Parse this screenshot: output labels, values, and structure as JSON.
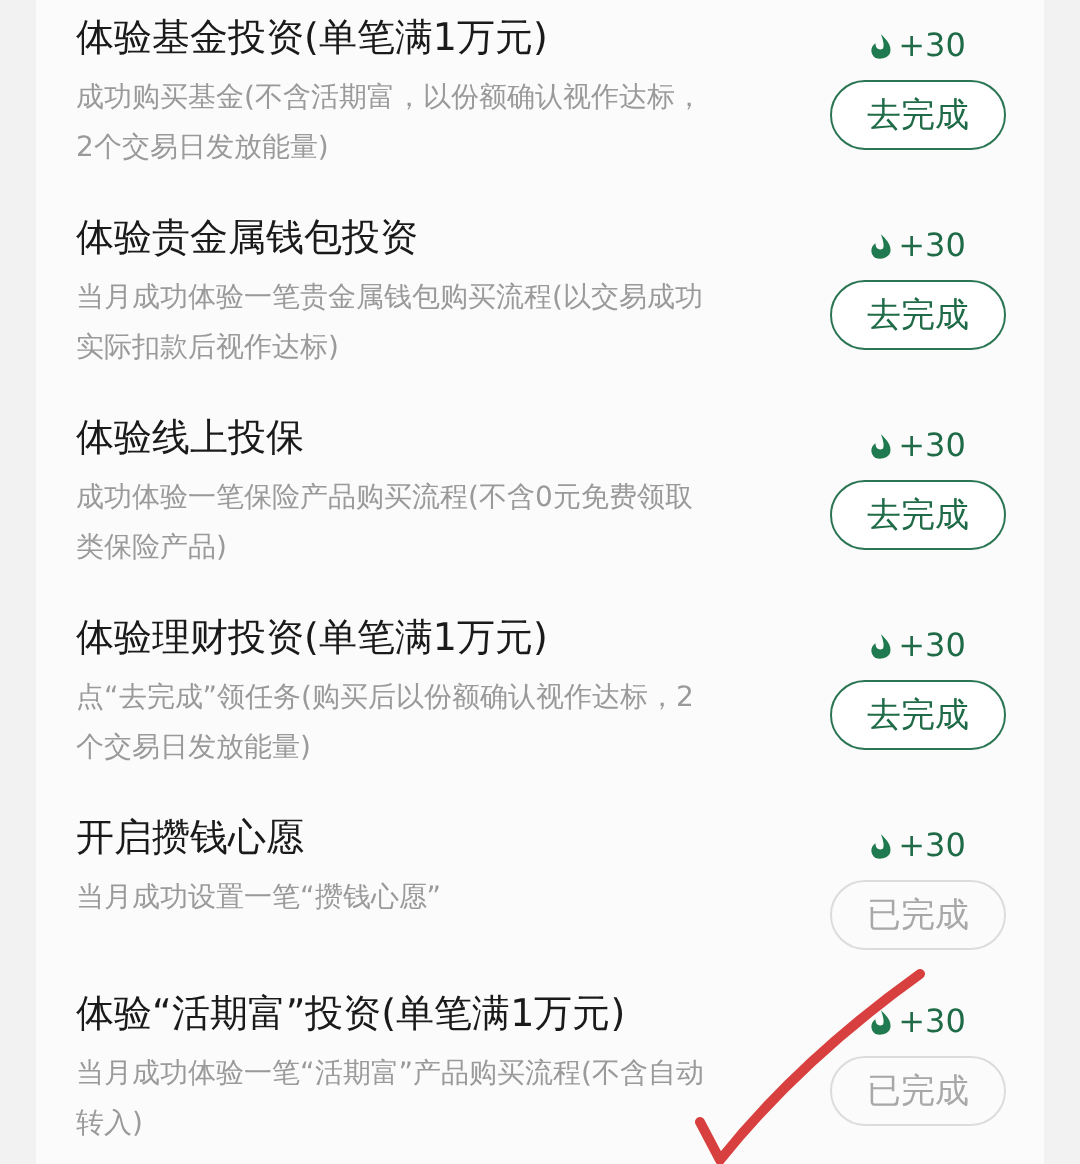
{
  "tasks": [
    {
      "title": "体验基金投资(单笔满1万元)",
      "description": "成功购买基金(不含活期富，以份额确认视作达标，2个交易日发放能量)",
      "reward": "+30",
      "button": "去完成",
      "completed": false
    },
    {
      "title": "体验贵金属钱包投资",
      "description": "当月成功体验一笔贵金属钱包购买流程(以交易成功实际扣款后视作达标)",
      "reward": "+30",
      "button": "去完成",
      "completed": false
    },
    {
      "title": "体验线上投保",
      "description": "成功体验一笔保险产品购买流程(不含0元免费领取类保险产品)",
      "reward": "+30",
      "button": "去完成",
      "completed": false
    },
    {
      "title": "体验理财投资(单笔满1万元)",
      "description": "点“去完成”领任务(购买后以份额确认视作达标，2个交易日发放能量)",
      "reward": "+30",
      "button": "去完成",
      "completed": false
    },
    {
      "title": "开启攒钱心愿",
      "description": "当月成功设置一笔“攒钱心愿”",
      "reward": "+30",
      "button": "已完成",
      "completed": true
    },
    {
      "title": "体验“活期富”投资(单笔满1万元)",
      "description": "当月成功体验一笔“活期富”产品购买流程(不含自动转入)",
      "reward": "+30",
      "button": "已完成",
      "completed": true
    }
  ]
}
